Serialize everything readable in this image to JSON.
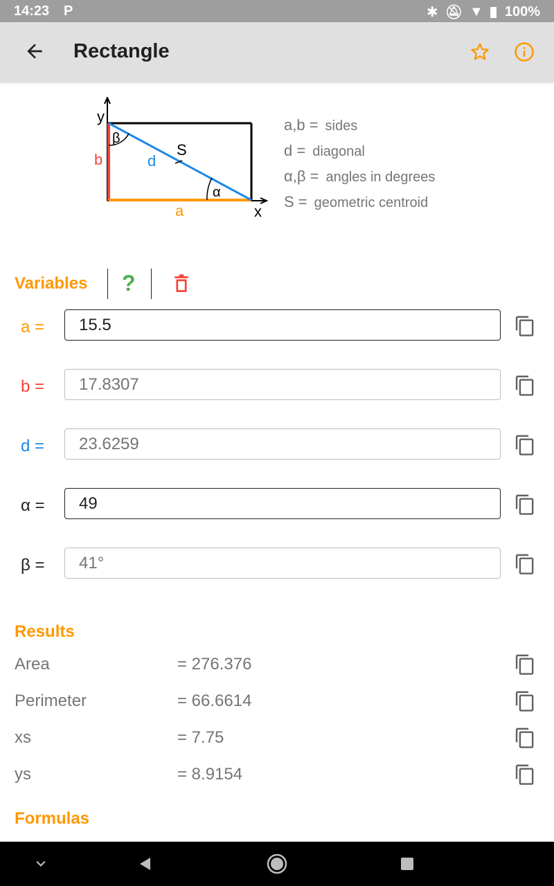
{
  "status": {
    "time": "14:23",
    "battery": "100%"
  },
  "appbar": {
    "title": "Rectangle"
  },
  "diagram_labels": {
    "y": "y",
    "x": "x",
    "beta": "β",
    "alpha": "α",
    "S": "S",
    "d": "d",
    "a": "a",
    "b": "b"
  },
  "legend": [
    {
      "sym": "a,b =",
      "desc": "sides"
    },
    {
      "sym": "d =",
      "desc": "diagonal"
    },
    {
      "sym": "α,β =",
      "desc": "angles in degrees"
    },
    {
      "sym": "S =",
      "desc": "geometric centroid"
    }
  ],
  "variables": {
    "title": "Variables",
    "help_label": "?",
    "rows": [
      {
        "label": "a  =",
        "value": "15.5",
        "color": "#ff9800"
      },
      {
        "label": "b  =",
        "value": "17.8307",
        "color": "#f44336"
      },
      {
        "label": "d  =",
        "value": "23.6259",
        "color": "#1e88e5"
      },
      {
        "label": "α  =",
        "value": "49",
        "color": "#212121"
      },
      {
        "label": "β  =",
        "value": "41°",
        "color": "#212121"
      }
    ]
  },
  "results": {
    "title": "Results",
    "rows": [
      {
        "label": "Area",
        "value": "= 276.376"
      },
      {
        "label": "Perimeter",
        "value": "= 66.6614"
      },
      {
        "label": "xs",
        "value": "= 7.75"
      },
      {
        "label": "ys",
        "value": "= 8.9154"
      }
    ]
  },
  "formulas": {
    "title": "Formulas"
  },
  "colors": {
    "accent": "#ff9800",
    "side_a": "#ff9800",
    "side_b": "#f44336",
    "diagonal": "#1e88e5",
    "help": "#4caf50",
    "delete": "#f44336"
  }
}
